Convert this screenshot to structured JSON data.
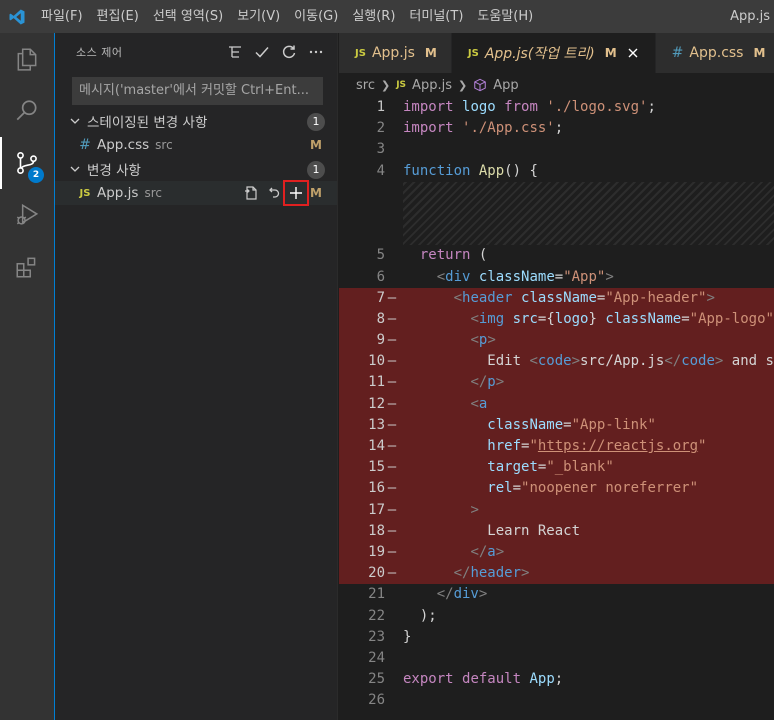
{
  "titlebar": {
    "menu": [
      "파일(F)",
      "편집(E)",
      "선택 영역(S)",
      "보기(V)",
      "이동(G)",
      "실행(R)",
      "터미널(T)",
      "도움말(H)"
    ],
    "window_title": "App.js"
  },
  "activity": {
    "scm_badge": "2"
  },
  "sidebar": {
    "title": "소스 제어",
    "commit_placeholder": "메시지('master'에서 커밋할 Ctrl+Ent...",
    "staged": {
      "label": "스테이징된 변경 사항",
      "count": "1",
      "files": [
        {
          "name": "App.css",
          "desc": "src",
          "status": "M"
        }
      ]
    },
    "changes": {
      "label": "변경 사항",
      "count": "1",
      "files": [
        {
          "name": "App.js",
          "desc": "src",
          "status": "M"
        }
      ]
    }
  },
  "editor": {
    "tabs": [
      {
        "icon": "JS",
        "label": "App.js",
        "mod": "M"
      },
      {
        "icon": "JS",
        "label": "App.js(작업 트리)",
        "mod": "M"
      },
      {
        "icon": "#",
        "label": "App.css",
        "mod": "M"
      }
    ],
    "breadcrumb": {
      "folder": "src",
      "file": "App.js",
      "file_icon": "JS",
      "symbol": "App"
    },
    "lines": {
      "n1": "1",
      "n2": "2",
      "n3": "3",
      "n4": "4",
      "n5": "5",
      "n6": "6",
      "n7": "7",
      "n8": "8",
      "n9": "9",
      "n10": "10",
      "n11": "11",
      "n12": "12",
      "n13": "13",
      "n14": "14",
      "n15": "15",
      "n16": "16",
      "n17": "17",
      "n18": "18",
      "n19": "19",
      "n20": "20",
      "n21": "21",
      "n22": "22",
      "n23": "23",
      "n24": "24",
      "n25": "25",
      "n26": "26",
      "del_mark": "—"
    }
  }
}
